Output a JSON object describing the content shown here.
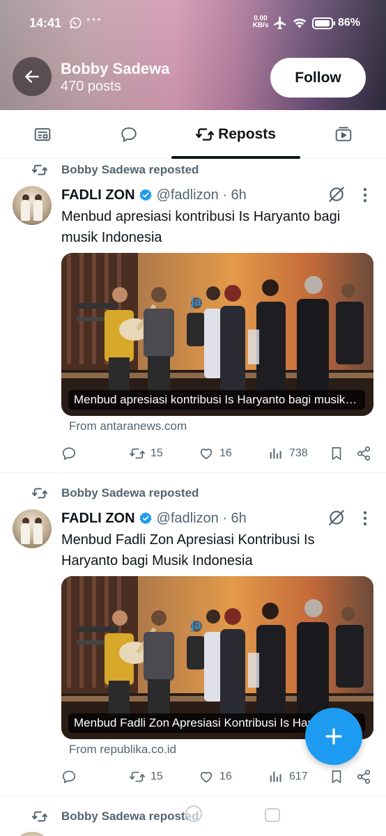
{
  "status_bar": {
    "time": "14:41",
    "more": "···",
    "net_speed_value": "0.00",
    "net_speed_unit": "KB/s",
    "battery": "86%"
  },
  "header": {
    "profile_name": "Bobby Sadewa",
    "posts_count": "470 posts",
    "follow_label": "Follow",
    "gradient_colors": [
      "#a39597",
      "#d39ab2",
      "#6b5077",
      "#2f2a3e"
    ]
  },
  "tabs": [
    {
      "icon": "feed-icon",
      "label": ""
    },
    {
      "icon": "speech-bubble-icon",
      "label": ""
    },
    {
      "icon": "repost-icon",
      "label": "Reposts",
      "active": true
    },
    {
      "icon": "video-icon",
      "label": ""
    }
  ],
  "posts": [
    {
      "repost_text": "Bobby Sadewa reposted",
      "author": "FADLI ZON",
      "handle_time": "@fadlizon · 6h",
      "text": "Menbud apresiasi kontribusi Is Haryanto bagi musik Indonesia",
      "media_caption": "Menbud apresiasi kontribusi Is Haryanto bagi musik Indonesia",
      "source": "From antaranews.com",
      "replies": "",
      "reposts": "15",
      "likes": "16",
      "views": "738"
    },
    {
      "repost_text": "Bobby Sadewa reposted",
      "author": "FADLI ZON",
      "handle_time": "@fadlizon · 6h",
      "text": "Menbud Fadli Zon Apresiasi Kontribusi Is Haryanto bagi Musik Indonesia",
      "media_caption": "Menbud Fadli Zon Apresiasi Kontribusi Is Haryanto bagi Musik Indonesia",
      "source": "From republika.co.id",
      "replies": "",
      "reposts": "15",
      "likes": "16",
      "views": "617"
    },
    {
      "repost_text": "Bobby Sadewa reposted"
    }
  ],
  "colors": {
    "accent": "#1d9bf0",
    "text_primary": "#0f1419",
    "text_secondary": "#536471",
    "divider": "#eff3f4"
  }
}
